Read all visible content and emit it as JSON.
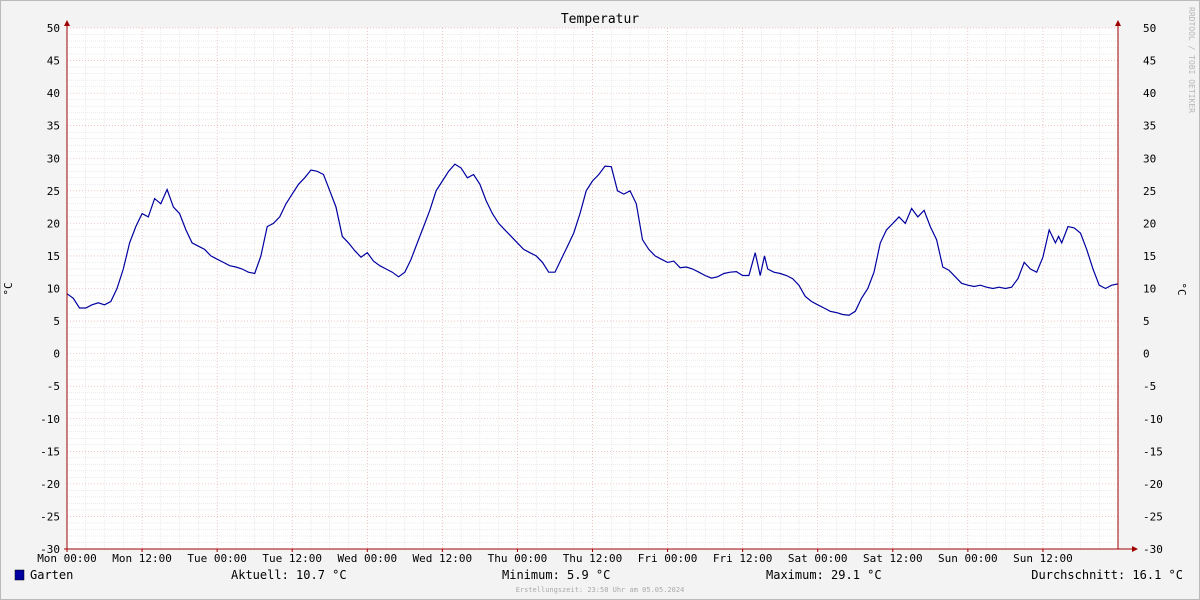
{
  "chart_data": {
    "type": "line",
    "title": "Temperatur",
    "ylabel": "°C",
    "ylim": [
      -30,
      50
    ],
    "y_ticks": [
      50,
      45,
      40,
      35,
      30,
      25,
      20,
      15,
      10,
      5,
      0,
      -5,
      -10,
      -15,
      -20,
      -25,
      -30
    ],
    "x_unit": "hours since Mon 00:00",
    "xlim": [
      0,
      168
    ],
    "x_ticks": [
      {
        "x": 0,
        "label": "Mon 00:00"
      },
      {
        "x": 12,
        "label": "Mon 12:00"
      },
      {
        "x": 24,
        "label": "Tue 00:00"
      },
      {
        "x": 36,
        "label": "Tue 12:00"
      },
      {
        "x": 48,
        "label": "Wed 00:00"
      },
      {
        "x": 60,
        "label": "Wed 12:00"
      },
      {
        "x": 72,
        "label": "Thu 00:00"
      },
      {
        "x": 84,
        "label": "Thu 12:00"
      },
      {
        "x": 96,
        "label": "Fri 00:00"
      },
      {
        "x": 108,
        "label": "Fri 12:00"
      },
      {
        "x": 120,
        "label": "Sat 00:00"
      },
      {
        "x": 132,
        "label": "Sat 12:00"
      },
      {
        "x": 144,
        "label": "Sun 00:00"
      },
      {
        "x": 156,
        "label": "Sun 12:00"
      }
    ],
    "grid": true,
    "legend_position": "bottom-left",
    "series": [
      {
        "name": "Garten",
        "color": "#0000a0",
        "points": [
          [
            0,
            9.2
          ],
          [
            1,
            8.5
          ],
          [
            2,
            7.0
          ],
          [
            3,
            7.0
          ],
          [
            4,
            7.5
          ],
          [
            5,
            7.8
          ],
          [
            6,
            7.5
          ],
          [
            7,
            8.0
          ],
          [
            8,
            10.0
          ],
          [
            9,
            13.0
          ],
          [
            10,
            17.0
          ],
          [
            11,
            19.5
          ],
          [
            12,
            21.5
          ],
          [
            13,
            21.0
          ],
          [
            14,
            23.8
          ],
          [
            15,
            23.0
          ],
          [
            16,
            25.2
          ],
          [
            17,
            22.5
          ],
          [
            18,
            21.5
          ],
          [
            19,
            19.0
          ],
          [
            20,
            17.0
          ],
          [
            21,
            16.5
          ],
          [
            22,
            16.0
          ],
          [
            23,
            15.0
          ],
          [
            24,
            14.5
          ],
          [
            25,
            14.0
          ],
          [
            26,
            13.5
          ],
          [
            27,
            13.3
          ],
          [
            28,
            13.0
          ],
          [
            29,
            12.5
          ],
          [
            30,
            12.3
          ],
          [
            31,
            15.0
          ],
          [
            32,
            19.5
          ],
          [
            33,
            20.0
          ],
          [
            34,
            21.0
          ],
          [
            35,
            23.0
          ],
          [
            36,
            24.5
          ],
          [
            37,
            26.0
          ],
          [
            38,
            27.0
          ],
          [
            39,
            28.2
          ],
          [
            40,
            28.0
          ],
          [
            41,
            27.5
          ],
          [
            42,
            25.0
          ],
          [
            43,
            22.5
          ],
          [
            44,
            18.0
          ],
          [
            45,
            17.0
          ],
          [
            46,
            15.8
          ],
          [
            47,
            14.8
          ],
          [
            48,
            15.5
          ],
          [
            49,
            14.2
          ],
          [
            50,
            13.5
          ],
          [
            51,
            13.0
          ],
          [
            52,
            12.5
          ],
          [
            53,
            11.8
          ],
          [
            54,
            12.5
          ],
          [
            55,
            14.5
          ],
          [
            56,
            17.0
          ],
          [
            57,
            19.5
          ],
          [
            58,
            22.0
          ],
          [
            59,
            25.0
          ],
          [
            60,
            26.5
          ],
          [
            61,
            28.0
          ],
          [
            62,
            29.1
          ],
          [
            63,
            28.5
          ],
          [
            64,
            27.0
          ],
          [
            65,
            27.5
          ],
          [
            66,
            26.0
          ],
          [
            67,
            23.5
          ],
          [
            68,
            21.5
          ],
          [
            69,
            20.0
          ],
          [
            70,
            19.0
          ],
          [
            71,
            18.0
          ],
          [
            72,
            17.0
          ],
          [
            73,
            16.0
          ],
          [
            74,
            15.5
          ],
          [
            75,
            15.0
          ],
          [
            76,
            14.0
          ],
          [
            77,
            12.5
          ],
          [
            78,
            12.5
          ],
          [
            79,
            14.5
          ],
          [
            80,
            16.5
          ],
          [
            81,
            18.5
          ],
          [
            82,
            21.5
          ],
          [
            83,
            25.0
          ],
          [
            84,
            26.5
          ],
          [
            85,
            27.5
          ],
          [
            86,
            28.8
          ],
          [
            87,
            28.7
          ],
          [
            88,
            25.0
          ],
          [
            89,
            24.5
          ],
          [
            90,
            25.0
          ],
          [
            91,
            23.0
          ],
          [
            92,
            17.5
          ],
          [
            93,
            16.0
          ],
          [
            94,
            15.0
          ],
          [
            95,
            14.5
          ],
          [
            96,
            14.0
          ],
          [
            97,
            14.2
          ],
          [
            98,
            13.2
          ],
          [
            99,
            13.3
          ],
          [
            100,
            13.0
          ],
          [
            101,
            12.5
          ],
          [
            102,
            12.0
          ],
          [
            103,
            11.6
          ],
          [
            104,
            11.8
          ],
          [
            105,
            12.3
          ],
          [
            106,
            12.5
          ],
          [
            107,
            12.6
          ],
          [
            108,
            12.0
          ],
          [
            109,
            12.0
          ],
          [
            110,
            15.5
          ],
          [
            110.8,
            12.0
          ],
          [
            111.5,
            15.0
          ],
          [
            112,
            13.0
          ],
          [
            113,
            12.5
          ],
          [
            114,
            12.3
          ],
          [
            115,
            12.0
          ],
          [
            116,
            11.5
          ],
          [
            117,
            10.5
          ],
          [
            118,
            8.8
          ],
          [
            119,
            8.0
          ],
          [
            120,
            7.5
          ],
          [
            121,
            7.0
          ],
          [
            122,
            6.5
          ],
          [
            123,
            6.3
          ],
          [
            124,
            6.0
          ],
          [
            125,
            5.9
          ],
          [
            126,
            6.5
          ],
          [
            127,
            8.5
          ],
          [
            128,
            10.0
          ],
          [
            129,
            12.5
          ],
          [
            130,
            17.0
          ],
          [
            131,
            19.0
          ],
          [
            132,
            20.0
          ],
          [
            133,
            21.0
          ],
          [
            134,
            20.0
          ],
          [
            135,
            22.3
          ],
          [
            136,
            21.0
          ],
          [
            137,
            22.0
          ],
          [
            138,
            19.5
          ],
          [
            139,
            17.5
          ],
          [
            140,
            13.3
          ],
          [
            141,
            12.8
          ],
          [
            142,
            11.8
          ],
          [
            143,
            10.8
          ],
          [
            144,
            10.5
          ],
          [
            145,
            10.3
          ],
          [
            146,
            10.5
          ],
          [
            147,
            10.2
          ],
          [
            148,
            10.0
          ],
          [
            149,
            10.2
          ],
          [
            150,
            10.0
          ],
          [
            151,
            10.2
          ],
          [
            152,
            11.5
          ],
          [
            153,
            14.0
          ],
          [
            154,
            13.0
          ],
          [
            155,
            12.5
          ],
          [
            156,
            14.8
          ],
          [
            157,
            19.0
          ],
          [
            158,
            17.0
          ],
          [
            158.5,
            18.0
          ],
          [
            159,
            17.0
          ],
          [
            160,
            19.5
          ],
          [
            161,
            19.3
          ],
          [
            162,
            18.5
          ],
          [
            163,
            16.0
          ],
          [
            164,
            13.0
          ],
          [
            165,
            10.5
          ],
          [
            166,
            10.0
          ],
          [
            167,
            10.5
          ],
          [
            168,
            10.7
          ]
        ]
      }
    ]
  },
  "watermark": "RRDTOOL / TOBI OETIKER",
  "legend": {
    "series_label": "Garten",
    "current": "Aktuell: 10.7 °C",
    "minimum": "Minimum: 5.9 °C",
    "maximum": "Maximum: 29.1 °C",
    "average": "Durchschnitt: 16.1 °C"
  },
  "footer": "Erstellungszeit: 23:58 Uhr am 05.05.2024",
  "colors": {
    "background": "#f3f3f3",
    "plot_background": "#ffffff",
    "grid_major": "#e8a0a0",
    "grid_minor": "#d8d8d8",
    "axis": "#a00000",
    "series": "#0000a0"
  }
}
